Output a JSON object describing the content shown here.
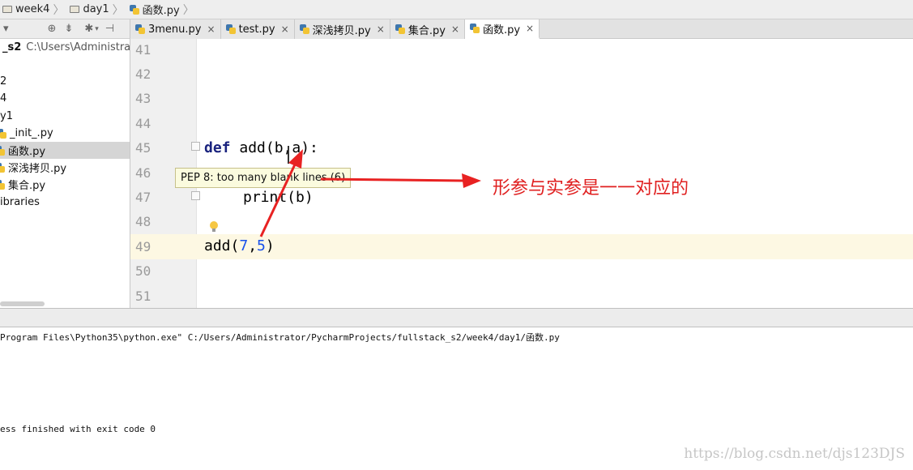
{
  "breadcrumb": {
    "items": [
      "week4",
      "day1",
      "函数.py"
    ]
  },
  "project_toolbar": {
    "dropdown": "▾",
    "icons": [
      "target-icon",
      "collapse-icon",
      "gear-icon",
      "pin-icon"
    ]
  },
  "tabs": [
    {
      "label": "3menu.py",
      "active": false
    },
    {
      "label": "test.py",
      "active": false
    },
    {
      "label": "深浅拷贝.py",
      "active": false
    },
    {
      "label": "集合.py",
      "active": false
    },
    {
      "label": "函数.py",
      "active": true
    }
  ],
  "sidebar": {
    "root_name": "_s2",
    "root_path": "C:\\Users\\Administrator",
    "items": [
      "2",
      "4",
      "y1",
      "_init_.py",
      "函数.py",
      "深浅拷贝.py",
      "集合.py",
      "ibraries"
    ]
  },
  "editor": {
    "line_numbers": [
      "41",
      "42",
      "43",
      "44",
      "45",
      "46",
      "47",
      "48",
      "49",
      "50",
      "51"
    ],
    "code": {
      "def_kw": "def",
      "def_rest": " add(b,a):",
      "print_line": "print(b)",
      "call_prefix": "add(",
      "arg1": "7",
      "comma": ",",
      "arg2": "5",
      "call_suffix": ")"
    },
    "tooltip": "PEP 8: too many blank lines (6)",
    "annotation": "形参与实参是一一对应的"
  },
  "console": {
    "command": "Program Files\\Python35\\python.exe\" C:/Users/Administrator/PycharmProjects/fullstack_s2/week4/day1/函数.py",
    "exit": "ess finished with exit code 0"
  },
  "watermark": "https://blog.csdn.net/djs123DJS",
  "colors": {
    "arrow": "#e82222",
    "keyword": "#1a237e",
    "number": "#1750eb",
    "current_line": "#fdf8e3",
    "tooltip_bg": "#fbfbde"
  }
}
